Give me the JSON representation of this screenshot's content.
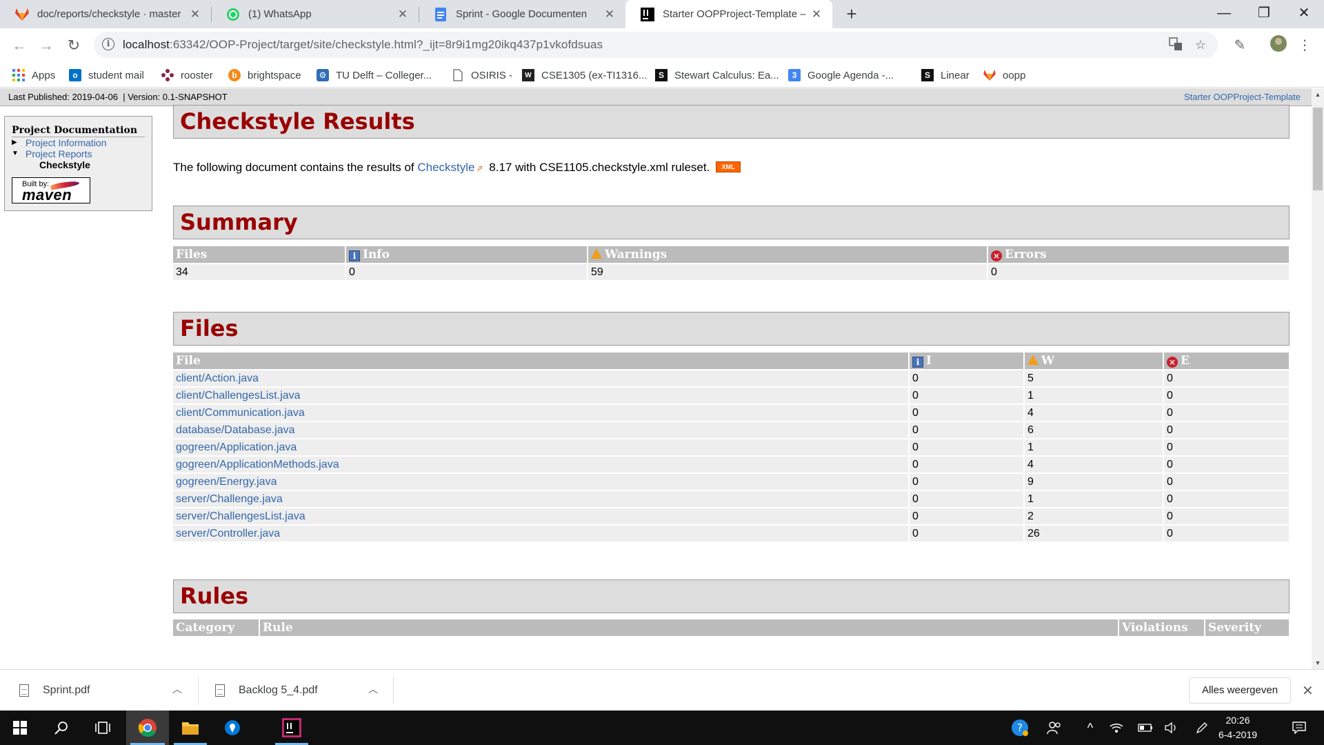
{
  "browser": {
    "tabs": [
      {
        "title": "doc/reports/checkstyle · master ·",
        "icon": "gitlab-icon",
        "active": false
      },
      {
        "title": "(1) WhatsApp",
        "icon": "whatsapp-icon",
        "active": false
      },
      {
        "title": "Sprint - Google Documenten",
        "icon": "google-docs-icon",
        "active": false
      },
      {
        "title": "Starter OOPProject-Template – C",
        "icon": "intellij-icon",
        "active": true
      }
    ],
    "new_tab_label": "+",
    "url_host": "localhost",
    "url_path": ":63342/OOP-Project/target/site/checkstyle.html?_ijt=8r9i1mg20ikq437p1vkofdsuas",
    "bookmarks": [
      {
        "label": "Apps",
        "icon": "apps-grid-icon"
      },
      {
        "label": "student mail",
        "icon": "outlook-icon"
      },
      {
        "label": "rooster",
        "icon": "rooster-icon"
      },
      {
        "label": "brightspace",
        "icon": "brightspace-icon"
      },
      {
        "label": "TU Delft – Colleger...",
        "icon": "tu-delft-icon"
      },
      {
        "label": "OSIRIS -",
        "icon": "page-icon"
      },
      {
        "label": "CSE1305 (ex-TI1316...",
        "icon": "wiki-icon"
      },
      {
        "label": "Stewart Calculus: Ea...",
        "icon": "stewart-icon"
      },
      {
        "label": "Google Agenda -...",
        "icon": "google-calendar-icon"
      },
      {
        "label": "Linear",
        "icon": "stewart-icon"
      },
      {
        "label": "oopp",
        "icon": "gitlab-icon"
      }
    ]
  },
  "site": {
    "banner_left": "Last Published: 2019-04-06  | Version: 0.1-SNAPSHOT",
    "banner_right": "Starter OOPProject-Template",
    "nav_heading": "Project Documentation",
    "nav_items": [
      "Project Information",
      "Project Reports"
    ],
    "nav_current": "Checkstyle",
    "badge_built": "Built by:",
    "badge_name": "maven"
  },
  "report": {
    "title": "Checkstyle Results",
    "intro_before": "The following document contains the results of ",
    "intro_link": "Checkstyle",
    "intro_after": " 8.17 with CSE1105.checkstyle.xml ruleset.",
    "xml_badge": "XML",
    "summary_title": "Summary",
    "summary_headers": {
      "files": "Files",
      "info": "Info",
      "warnings": "Warnings",
      "errors": "Errors"
    },
    "summary_values": {
      "files": "34",
      "info": "0",
      "warnings": "59",
      "errors": "0"
    },
    "files_title": "Files",
    "files_headers": {
      "file": "File",
      "i": "I",
      "w": "W",
      "e": "E"
    },
    "files": [
      {
        "name": "client/Action.java",
        "i": "0",
        "w": "5",
        "e": "0"
      },
      {
        "name": "client/ChallengesList.java",
        "i": "0",
        "w": "1",
        "e": "0"
      },
      {
        "name": "client/Communication.java",
        "i": "0",
        "w": "4",
        "e": "0"
      },
      {
        "name": "database/Database.java",
        "i": "0",
        "w": "6",
        "e": "0"
      },
      {
        "name": "gogreen/Application.java",
        "i": "0",
        "w": "1",
        "e": "0"
      },
      {
        "name": "gogreen/ApplicationMethods.java",
        "i": "0",
        "w": "4",
        "e": "0"
      },
      {
        "name": "gogreen/Energy.java",
        "i": "0",
        "w": "9",
        "e": "0"
      },
      {
        "name": "server/Challenge.java",
        "i": "0",
        "w": "1",
        "e": "0"
      },
      {
        "name": "server/ChallengesList.java",
        "i": "0",
        "w": "2",
        "e": "0"
      },
      {
        "name": "server/Controller.java",
        "i": "0",
        "w": "26",
        "e": "0"
      }
    ],
    "rules_title": "Rules",
    "rules_headers": {
      "category": "Category",
      "rule": "Rule",
      "violations": "Violations",
      "severity": "Severity"
    }
  },
  "downloads": {
    "items": [
      "Sprint.pdf",
      "Backlog 5_4.pdf"
    ],
    "show_all": "Alles weergeven"
  },
  "taskbar": {
    "time": "20:26",
    "date": "6-4-2019"
  }
}
